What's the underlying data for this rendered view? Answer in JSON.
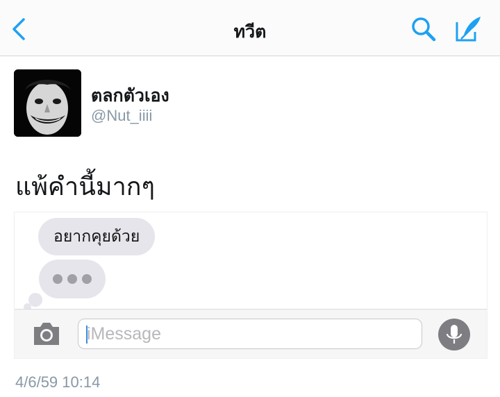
{
  "navbar": {
    "title": "ทวีต",
    "back_icon": "chevron-left-icon",
    "search_icon": "search-icon",
    "compose_icon": "compose-tweet-icon",
    "accent": "#1da1f2"
  },
  "tweet": {
    "author": {
      "display_name": "ตลกตัวเอง",
      "handle": "@Nut_iiii"
    },
    "text": "แพ้คำนี้มากๆ",
    "timestamp": "4/6/59 10:14"
  },
  "embedded_screenshot": {
    "message_bubble": "อยากคุยด้วย",
    "typing_indicator_icon": "typing-dots-icon",
    "input": {
      "placeholder": "iMessage",
      "value": ""
    },
    "camera_icon": "camera-icon",
    "mic_icon": "microphone-icon"
  },
  "colors": {
    "text": "#14171a",
    "secondary": "#8899a6",
    "bubble": "#e6e5eb"
  }
}
